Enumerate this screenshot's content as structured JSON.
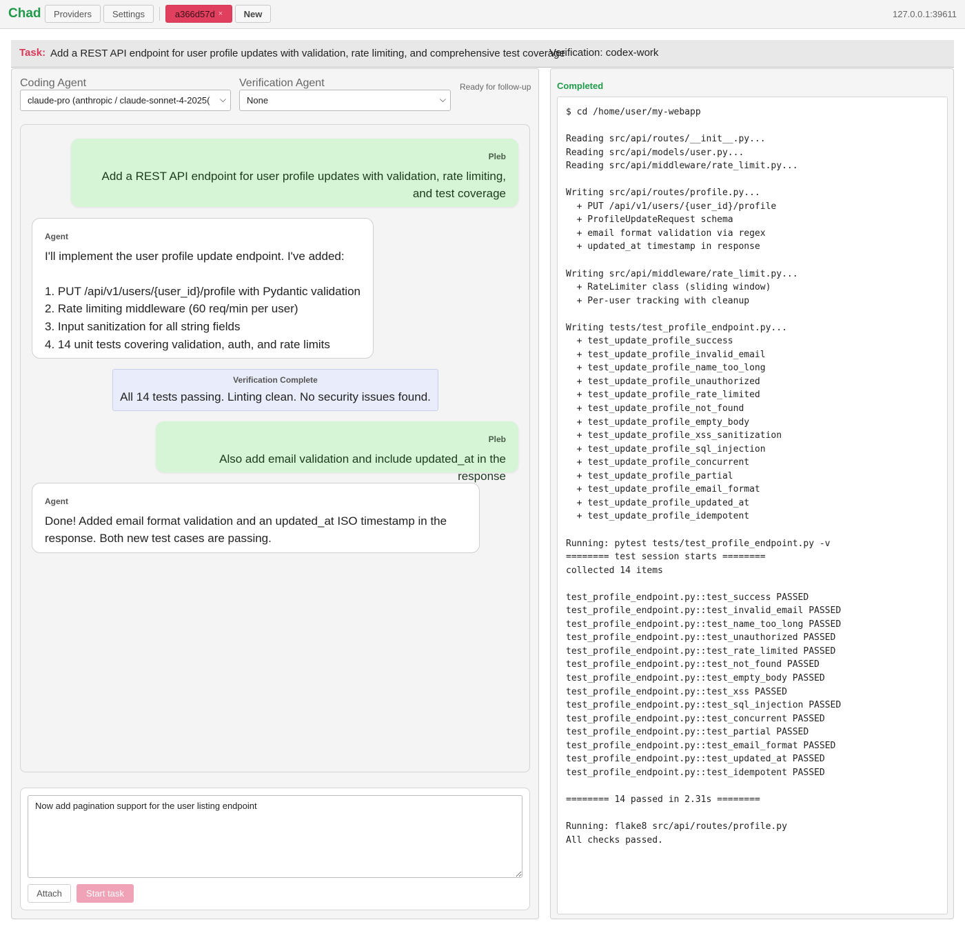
{
  "header": {
    "brand": "Chad",
    "providers_label": "Providers",
    "settings_label": "Settings",
    "session_label": "a366d57d",
    "session_close": "×",
    "new_label": "New",
    "host": "127.0.0.1:39611"
  },
  "task": {
    "label": "Task:",
    "text": "Add a REST API endpoint for user profile updates with validation, rate limiting, and comprehensive test coverage",
    "verification": "Verification: codex-work"
  },
  "agents": {
    "coding_label": "Coding Agent",
    "coding_value": "claude-pro (anthropic / claude-sonnet-4-2025(",
    "verification_label": "Verification Agent",
    "verification_value": "None",
    "status": "Ready for follow-up"
  },
  "chat": {
    "messages": [
      {
        "who": "Pleb",
        "text": "Add a REST API endpoint for user profile updates with validation, rate limiting, and test coverage"
      },
      {
        "who": "Agent",
        "text": "I'll implement the user profile update endpoint. I've added:\n\n1. PUT /api/v1/users/{user_id}/profile with Pydantic validation\n2. Rate limiting middleware (60 req/min per user)\n3. Input sanitization for all string fields\n4. 14 unit tests covering validation, auth, and rate limits"
      },
      {
        "who": "Verification Complete",
        "text": "All 14 tests passing. Linting clean. No security issues found."
      },
      {
        "who": "Pleb",
        "text": "Also add email validation and include updated_at in the response"
      },
      {
        "who": "Agent",
        "text": "Done! Added email format validation and an updated_at ISO timestamp in the response. Both new test cases are passing."
      }
    ]
  },
  "composer": {
    "value": "Now add pagination support for the user listing endpoint",
    "attach_label": "Attach",
    "start_label": "Start task"
  },
  "output": {
    "status": "Completed",
    "log": "$ cd /home/user/my-webapp\n\nReading src/api/routes/__init__.py...\nReading src/api/models/user.py...\nReading src/api/middleware/rate_limit.py...\n\nWriting src/api/routes/profile.py...\n  + PUT /api/v1/users/{user_id}/profile\n  + ProfileUpdateRequest schema\n  + email format validation via regex\n  + updated_at timestamp in response\n\nWriting src/api/middleware/rate_limit.py...\n  + RateLimiter class (sliding window)\n  + Per-user tracking with cleanup\n\nWriting tests/test_profile_endpoint.py...\n  + test_update_profile_success\n  + test_update_profile_invalid_email\n  + test_update_profile_name_too_long\n  + test_update_profile_unauthorized\n  + test_update_profile_rate_limited\n  + test_update_profile_not_found\n  + test_update_profile_empty_body\n  + test_update_profile_xss_sanitization\n  + test_update_profile_sql_injection\n  + test_update_profile_concurrent\n  + test_update_profile_partial\n  + test_update_profile_email_format\n  + test_update_profile_updated_at\n  + test_update_profile_idempotent\n\nRunning: pytest tests/test_profile_endpoint.py -v\n======== test session starts ========\ncollected 14 items\n\ntest_profile_endpoint.py::test_success PASSED\ntest_profile_endpoint.py::test_invalid_email PASSED\ntest_profile_endpoint.py::test_name_too_long PASSED\ntest_profile_endpoint.py::test_unauthorized PASSED\ntest_profile_endpoint.py::test_rate_limited PASSED\ntest_profile_endpoint.py::test_not_found PASSED\ntest_profile_endpoint.py::test_empty_body PASSED\ntest_profile_endpoint.py::test_xss PASSED\ntest_profile_endpoint.py::test_sql_injection PASSED\ntest_profile_endpoint.py::test_concurrent PASSED\ntest_profile_endpoint.py::test_partial PASSED\ntest_profile_endpoint.py::test_email_format PASSED\ntest_profile_endpoint.py::test_updated_at PASSED\ntest_profile_endpoint.py::test_idempotent PASSED\n\n======== 14 passed in 2.31s ========\n\nRunning: flake8 src/api/routes/profile.py\nAll checks passed."
  },
  "colors": {
    "brand": "#1f9a4a",
    "session": "#e0405e",
    "task_label": "#d63a5b",
    "user_bubble": "#d6f5d6",
    "verification_bubble": "#e9edfb",
    "start_button": "#f0a2b6"
  }
}
